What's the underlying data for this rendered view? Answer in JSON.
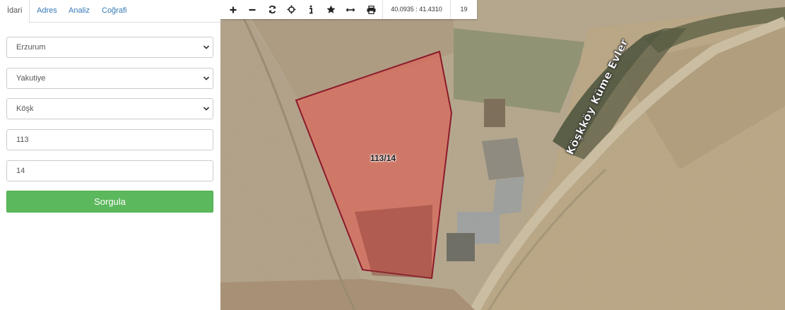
{
  "tabs": [
    {
      "label": "İdari"
    },
    {
      "label": "Adres"
    },
    {
      "label": "Analiz"
    },
    {
      "label": "Coğrafi"
    }
  ],
  "form": {
    "province": "Erzurum",
    "district": "Yakutiye",
    "neighborhood": "Köşk",
    "block": "113",
    "parcel": "14",
    "submit_label": "Sorgula"
  },
  "map": {
    "toolbar": {
      "icons": [
        "zoom-in-icon",
        "zoom-out-icon",
        "refresh-icon",
        "crosshair-icon",
        "info-icon",
        "star-icon",
        "measure-icon",
        "print-icon"
      ],
      "coordinates": "40.0935 : 41.4310",
      "zoom_level": "19"
    },
    "parcel_label": "113/14",
    "road_label": "Köşkköy Küme Evler",
    "parcel_fill": "#d9675a",
    "parcel_stroke": "#8b1a2b"
  }
}
